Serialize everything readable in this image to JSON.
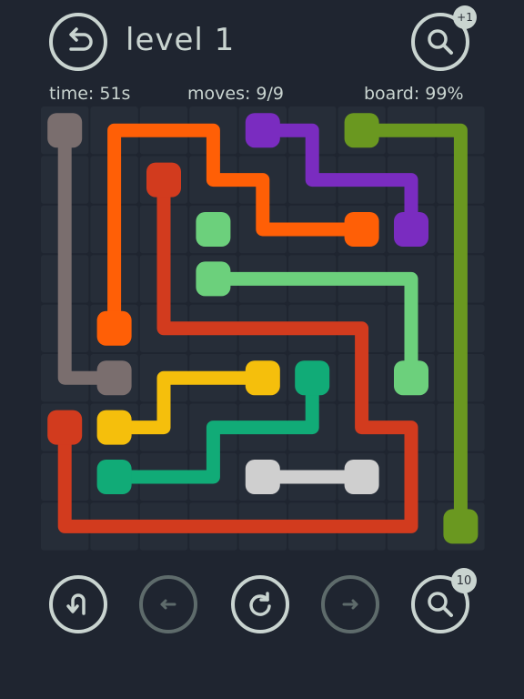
{
  "header": {
    "level_title": "level 1",
    "hint_badge": "+1"
  },
  "stats": {
    "time": "time: 51s",
    "moves": "moves: 9/9",
    "board": "board: 99%"
  },
  "footer": {
    "hint_count": "10"
  },
  "icons": {
    "back": "back-arrow-icon",
    "top_hint": "magnifier-icon",
    "undo": "undo-icon",
    "prev": "left-arrow-icon",
    "restart": "restart-icon",
    "next": "right-arrow-icon",
    "bottom_hint": "magnifier-icon"
  },
  "colors": {
    "background": "#1f2530",
    "grid": "#262d38",
    "ui": "#c9d4d0",
    "ui_dim": "#5e6b6b"
  },
  "grid": {
    "cols": 9,
    "rows": 9
  },
  "flows": [
    {
      "name": "taupe",
      "color": "#7a6e6e",
      "path": [
        [
          0,
          0
        ],
        [
          0,
          5
        ],
        [
          1,
          5
        ]
      ]
    },
    {
      "name": "orange",
      "color": "#ff5f06",
      "path": [
        [
          1,
          4
        ],
        [
          1,
          0
        ],
        [
          3,
          0
        ],
        [
          3,
          1
        ],
        [
          4,
          1
        ],
        [
          4,
          2
        ],
        [
          6,
          2
        ]
      ]
    },
    {
      "name": "purple",
      "color": "#7a2cc0",
      "path": [
        [
          4,
          0
        ],
        [
          5,
          0
        ],
        [
          5,
          1
        ],
        [
          7,
          1
        ],
        [
          7,
          2
        ]
      ]
    },
    {
      "name": "olive",
      "color": "#6a9820",
      "path": [
        [
          6,
          0
        ],
        [
          8,
          0
        ],
        [
          8,
          8
        ]
      ]
    },
    {
      "name": "red-short",
      "color": "#d23b1e",
      "path": [
        [
          2,
          1
        ],
        [
          2,
          4
        ],
        [
          6,
          4
        ],
        [
          6,
          6
        ],
        [
          7,
          6
        ],
        [
          7,
          8
        ],
        [
          0,
          8
        ],
        [
          0,
          6
        ]
      ]
    },
    {
      "name": "light-green",
      "color": "#6cd07c",
      "path": [
        [
          3,
          3
        ],
        [
          7,
          3
        ],
        [
          7,
          5
        ]
      ]
    },
    {
      "name": "yellow",
      "color": "#f5bf0c",
      "path": [
        [
          1,
          6
        ],
        [
          2,
          6
        ],
        [
          2,
          5
        ],
        [
          4,
          5
        ]
      ]
    },
    {
      "name": "teal",
      "color": "#11ab77",
      "path": [
        [
          1,
          7
        ],
        [
          3,
          7
        ],
        [
          3,
          6
        ],
        [
          5,
          6
        ],
        [
          5,
          5
        ]
      ]
    },
    {
      "name": "light-gray",
      "color": "#cfcfcf",
      "path": [
        [
          4,
          7
        ],
        [
          6,
          7
        ]
      ]
    }
  ],
  "dots": [
    {
      "name": "light-green-single",
      "color": "#6cd07c",
      "cell": [
        3,
        2
      ]
    }
  ]
}
